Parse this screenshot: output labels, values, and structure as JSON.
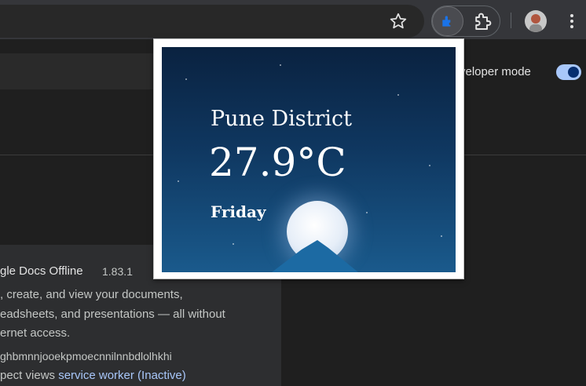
{
  "toolbar": {
    "icons": [
      "bookmark-star-icon",
      "weather-extension-icon",
      "extensions-puzzle-icon",
      "profile-avatar",
      "more-menu-icon"
    ]
  },
  "page": {
    "developer_mode_label": "veloper mode",
    "developer_mode_on": true,
    "extension": {
      "name": "gle Docs Offline",
      "version": "1.83.1",
      "description_lines": [
        ", create, and view your documents,",
        "eadsheets, and presentations — all without",
        "ernet access."
      ],
      "id": "ghbmnnjooekpmoecnnilnnbdlolhkhi",
      "inspect_prefix": "pect views",
      "inspect_link": "service worker (Inactive)"
    }
  },
  "popup": {
    "city": "Pune District",
    "temperature": "27.9°C",
    "day": "Friday"
  },
  "colors": {
    "accent": "#a8c7fa",
    "sky_top": "#0a2240",
    "sky_bottom": "#1a5a8c"
  }
}
